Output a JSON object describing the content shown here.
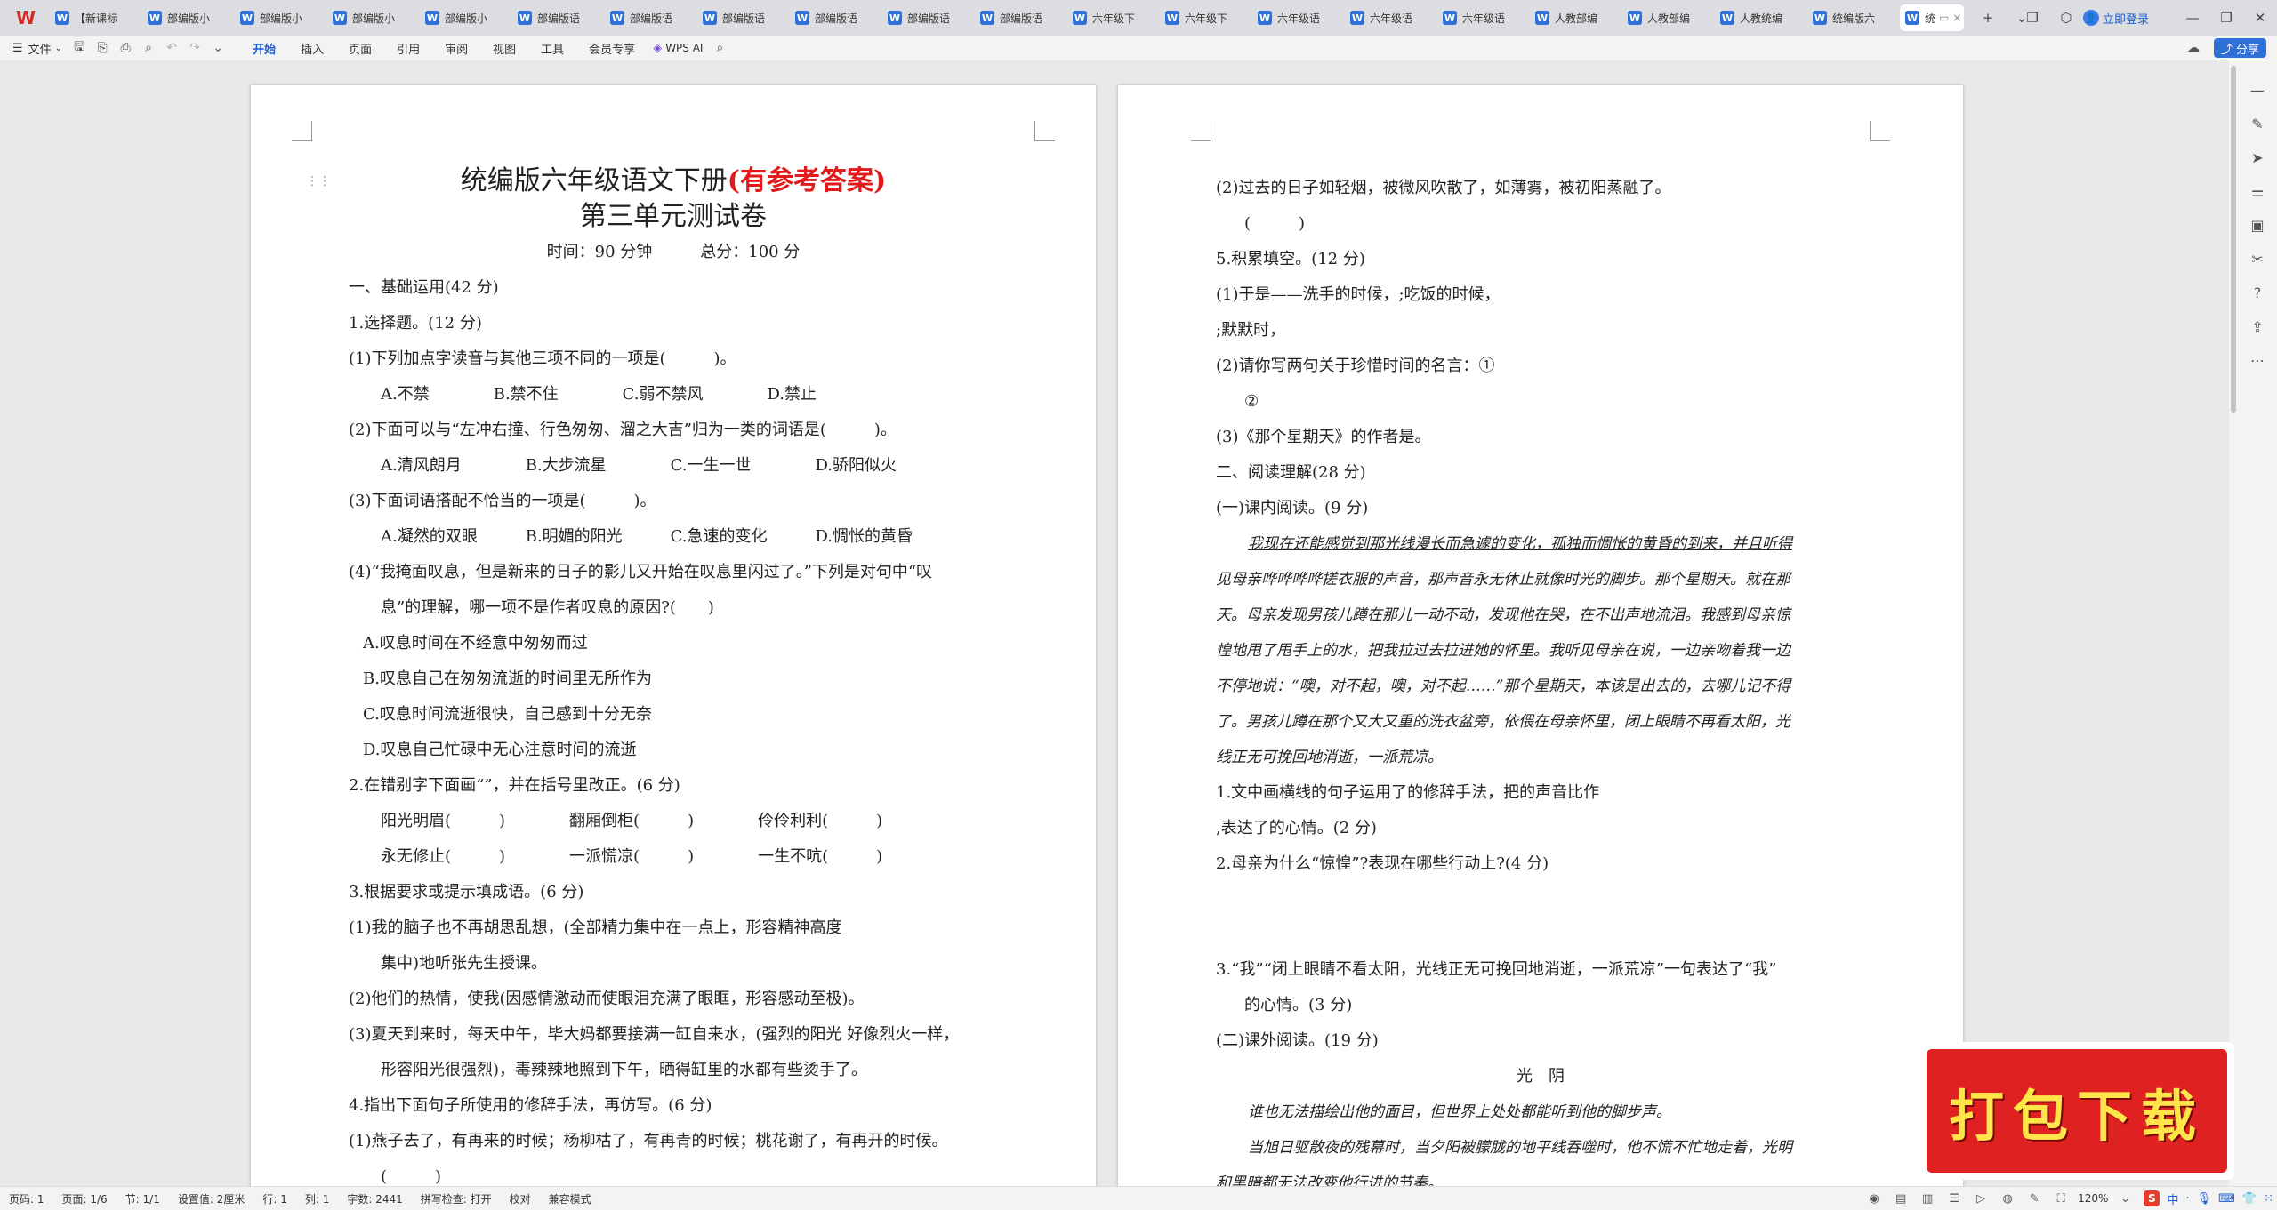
{
  "tabbar": {
    "logo": "W",
    "tabs": [
      {
        "label": "【新课标"
      },
      {
        "label": "部编版小"
      },
      {
        "label": "部编版小"
      },
      {
        "label": "部编版小"
      },
      {
        "label": "部编版小"
      },
      {
        "label": "部编版语"
      },
      {
        "label": "部编版语"
      },
      {
        "label": "部编版语"
      },
      {
        "label": "部编版语"
      },
      {
        "label": "部编版语"
      },
      {
        "label": "部编版语"
      },
      {
        "label": "六年级下"
      },
      {
        "label": "六年级下"
      },
      {
        "label": "六年级语"
      },
      {
        "label": "六年级语"
      },
      {
        "label": "六年级语"
      },
      {
        "label": "人教部编"
      },
      {
        "label": "人教部编"
      },
      {
        "label": "人教统编"
      },
      {
        "label": "统编版六"
      }
    ],
    "active_tab": {
      "label": "统"
    },
    "new_tab": "+",
    "tab_menu": "⌄",
    "login_label": "立即登录"
  },
  "toolbar": {
    "file_label": "文件",
    "menus": [
      "开始",
      "插入",
      "页面",
      "引用",
      "审阅",
      "视图",
      "工具",
      "会员专享"
    ],
    "ai_label": "WPS AI",
    "share_label": "分享"
  },
  "page1": {
    "title_line1": "统编版六年级语文下册",
    "title_line1_red": "(有参考答案)",
    "title_line2": "第三单元测试卷",
    "time_line": "时间：90 分钟　　　总分：100 分",
    "lines": [
      {
        "text": "一、基础运用(42 分)",
        "indent": 0
      },
      {
        "text": "1.选择题。(12 分)",
        "indent": 0
      },
      {
        "text": "(1)下列加点字读音与其他三项不同的一项是(　　　)。",
        "indent": 0
      },
      {
        "text": "A.不禁　　　　B.禁不住　　　　C.弱不禁风　　　　D.禁止",
        "indent": 1
      },
      {
        "text": "(2)下面可以与“左冲右撞、行色匆匆、溜之大吉”归为一类的词语是(　　　)。",
        "indent": 0
      },
      {
        "text": "A.清风朗月　　　　B.大步流星　　　　C.一生一世　　　　D.骄阳似火",
        "indent": 1
      },
      {
        "text": "(3)下面词语搭配不恰当的一项是(　　　)。",
        "indent": 0
      },
      {
        "text": "A.凝然的双眼　　　B.明媚的阳光　　　C.急速的变化　　　D.惆怅的黄昏",
        "indent": 1
      },
      {
        "text": "(4)“我掩面叹息，但是新来的日子的影儿又开始在叹息里闪过了。”下列是对句中“叹",
        "indent": 0
      },
      {
        "text": "息”的理解，哪一项不是作者叹息的原因?(　　)",
        "indent": 3
      },
      {
        "text": "A.叹息时间在不经意中匆匆而过",
        "indent": 2
      },
      {
        "text": "B.叹息自己在匆匆流逝的时间里无所作为",
        "indent": 2
      },
      {
        "text": "C.叹息时间流逝很快，自己感到十分无奈",
        "indent": 2
      },
      {
        "text": "D.叹息自己忙碌中无心注意时间的流逝",
        "indent": 2
      },
      {
        "text": "2.在错别字下面画“”，并在括号里改正。(6 分)",
        "indent": 0
      },
      {
        "text": "阳光明眉(　　　)　　　　翻厢倒柜(　　　)　　　　伶伶利利(　　　)",
        "indent": 1
      },
      {
        "text": "永无修止(　　　)　　　　一派慌凉(　　　)　　　　一生不吭(　　　)",
        "indent": 1
      },
      {
        "text": "3.根据要求或提示填成语。(6 分)",
        "indent": 0
      },
      {
        "text": "(1)我的脑子也不再胡思乱想，(全部精力集中在一点上，形容精神高度",
        "indent": 0
      },
      {
        "text": "集中)地听张先生授课。",
        "indent": 3
      },
      {
        "text": "(2)他们的热情，使我(因感情激动而使眼泪充满了眼眶，形容感动至极)。",
        "indent": 0
      },
      {
        "text": "(3)夏天到来时，每天中午，毕大妈都要接满一缸自来水，(强烈的阳光 好像烈火一样，",
        "indent": 0
      },
      {
        "text": "形容阳光很强烈)，毒辣辣地照到下午，晒得缸里的水都有些烫手了。",
        "indent": 3
      },
      {
        "text": "4.指出下面句子所使用的修辞手法，再仿写。(6 分)",
        "indent": 0
      },
      {
        "text": "(1)燕子去了，有再来的时候；杨柳枯了，有再青的时候；桃花谢了，有再开的时候。",
        "indent": 0
      },
      {
        "text": "(　　　)",
        "indent": 1
      }
    ]
  },
  "page2": {
    "lines": [
      {
        "text": "(2)过去的日子如轻烟，被微风吹散了，如薄雾，被初阳蒸融了。",
        "indent": 0,
        "style": ""
      },
      {
        "text": "(　　　)",
        "indent": 1,
        "style": ""
      },
      {
        "text": "5.积累填空。(12 分)",
        "indent": 0,
        "style": ""
      },
      {
        "text": "(1)于是——洗手的时候，;吃饭的时候，",
        "indent": 0,
        "style": ""
      },
      {
        "text": ";默默时，",
        "indent": 0,
        "style": ""
      },
      {
        "text": "(2)请你写两句关于珍惜时间的名言：①",
        "indent": 0,
        "style": ""
      },
      {
        "text": "②",
        "indent": 1,
        "style": ""
      },
      {
        "text": "(3)《那个星期天》的作者是。",
        "indent": 0,
        "style": ""
      },
      {
        "text": "二、阅读理解(28 分)",
        "indent": 0,
        "style": ""
      },
      {
        "text": "(一)课内阅读。(9 分)",
        "indent": 0,
        "style": ""
      },
      {
        "text": "我现在还能感觉到那光线漫长而急遽的变化，孤独而惆怅的黄昏的到来，并且听得",
        "indent": 1,
        "style": "kai ul"
      },
      {
        "text": "见母亲哗哗哗哗搓衣服的声音，那声音永无休止就像时光的脚步。那个星期天。就在那",
        "indent": 0,
        "style": "kai"
      },
      {
        "text": "天。母亲发现男孩儿蹲在那儿一动不动，发现他在哭，在不出声地流泪。我感到母亲惊",
        "indent": 0,
        "style": "kai"
      },
      {
        "text": "惶地甩了甩手上的水，把我拉过去拉进她的怀里。我听见母亲在说，一边亲吻着我一边",
        "indent": 0,
        "style": "kai"
      },
      {
        "text": "不停地说：“噢，对不起，噢，对不起……”那个星期天，本该是出去的，去哪儿记不得",
        "indent": 0,
        "style": "kai"
      },
      {
        "text": "了。男孩儿蹲在那个又大又重的洗衣盆旁，依偎在母亲怀里，闭上眼睛不再看太阳，光",
        "indent": 0,
        "style": "kai"
      },
      {
        "text": "线正无可挽回地消逝，一派荒凉。",
        "indent": 0,
        "style": "kai"
      },
      {
        "text": "1.文中画横线的句子运用了的修辞手法，把的声音比作",
        "indent": 0,
        "style": ""
      },
      {
        "text": ",表达了的心情。(2 分)",
        "indent": 0,
        "style": ""
      },
      {
        "text": "2.母亲为什么“惊惶”?表现在哪些行动上?(4 分)",
        "indent": 0,
        "style": ""
      }
    ],
    "q3_line1": "3.“我”“闭上眼睛不看太阳，光线正无可挽回地消逝，一派荒凉”一句表达了“我”",
    "q3_line2": "的心情。(3 分)",
    "section3": "(二)课外阅读。(19 分)",
    "article_title": "光　阴",
    "article_lines": [
      "谁也无法描绘出他的面目，但世界上处处都能听到他的脚步声。",
      "当旭日驱散夜的残幕时，当夕阳被朦胧的地平线吞噬时，他不慌不忙地走着，光明",
      "和黑暗都无法改变他行进的节奏。"
    ]
  },
  "statusbar": {
    "page_num": "页码: 1",
    "pages": "页面: 1/6",
    "section": "节: 1/1",
    "setting": "设置值: 2厘米",
    "row": "行: 1",
    "col": "列: 1",
    "words": "字数: 2441",
    "spell": "拼写检查: 打开",
    "proof": "校对",
    "compat": "兼容模式",
    "zoom": "120%",
    "ime_zh": "中"
  },
  "download_banner": {
    "label": "打包下载"
  }
}
